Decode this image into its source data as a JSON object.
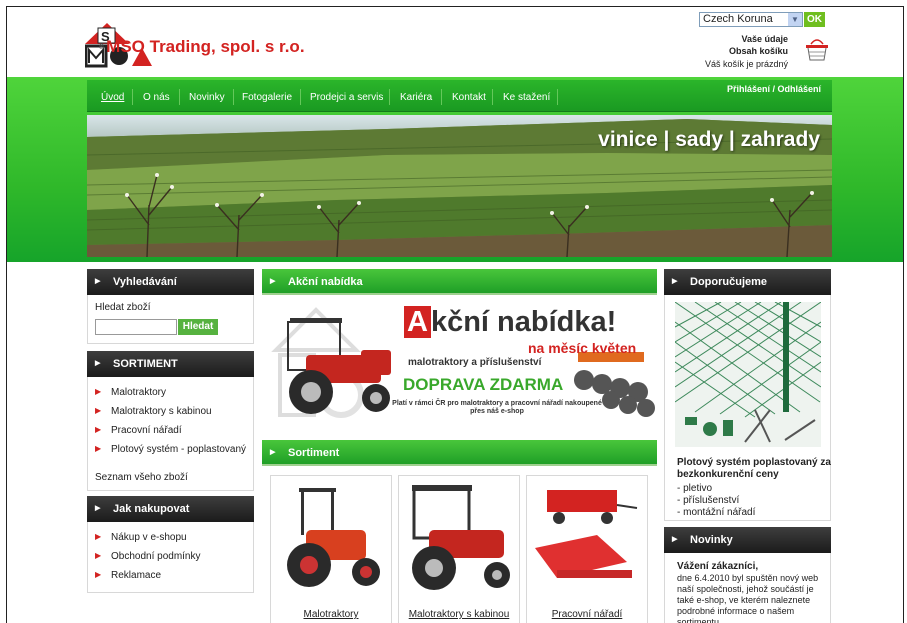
{
  "header": {
    "logo_name": "MSO Trading, spol. s r.o.",
    "currency": "Czech Koruna",
    "ok_label": "OK",
    "account_link": "Vaše údaje",
    "cart_link": "Obsah košíku",
    "cart_status": "Váš košík je prázdný"
  },
  "nav": {
    "items": [
      "Úvod",
      "O nás",
      "Novinky",
      "Fotogalerie",
      "Prodejci a servis",
      "Kariéra",
      "Kontakt",
      "Ke stažení"
    ],
    "login": "Přihlášení / Odhlášení"
  },
  "banner": {
    "title": "vinice | sady | zahrady"
  },
  "left": {
    "search_title": "Vyhledávání",
    "search_label": "Hledat zboží",
    "search_button": "Hledat",
    "sortiment_title": "SORTIMENT",
    "sortiment_items": [
      "Malotraktory",
      "Malotraktory s kabinou",
      "Pracovní nářadí",
      "Plotový systém - poplastovaný"
    ],
    "all_goods": "Seznam všeho zboží",
    "howto_title": "Jak nakupovat",
    "howto_items": [
      "Nákup v e-shopu",
      "Obchodní podmínky",
      "Reklamace"
    ]
  },
  "center": {
    "promo_header": "Akční nabídka",
    "promo_first_letter": "A",
    "promo_rest": "kční nabídka!",
    "promo_sub": "na měsíc květen",
    "promo_line": "malotraktory a příslušenství",
    "promo_ship": "DOPRAVA ZDARMA",
    "promo_note": "Platí v rámci ČR pro malotraktory a pracovní nářadí nakoupené přes náš e-shop",
    "sortiment_header": "Sortiment",
    "products": [
      "Malotraktory",
      "Malotraktory s kabinou",
      "Pracovní nářadí"
    ]
  },
  "right": {
    "recommend_title": "Doporučujeme",
    "rec_heading": "Plotový systém poplastovaný za bezkonkurenční ceny",
    "rec_items": [
      "- pletivo",
      "- příslušenství",
      "- montážní nářadí"
    ],
    "news_title": "Novinky",
    "news_greeting": "Vážení zákazníci,",
    "news_body": "dne 6.4.2010 byl spuštěn nový web naší společnosti, jehož součástí je také e-shop, ve kterém naleznete podrobné informace o našem sortimentu"
  }
}
